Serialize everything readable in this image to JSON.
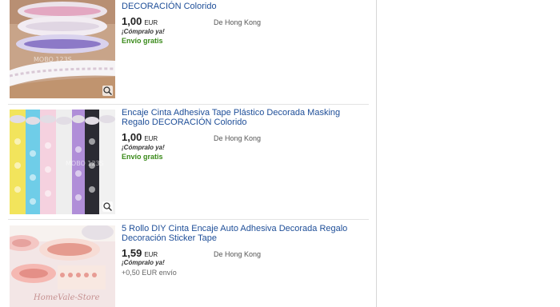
{
  "items": [
    {
      "title": "DECORACIÓN Colorido",
      "price": "1,00",
      "currency": "EUR",
      "buy_now": "¡Cómpralo ya!",
      "origin": "De Hong Kong",
      "shipping": "Envío gratis",
      "image_watermark": "MOBO 123S"
    },
    {
      "title": "Encaje Cinta Adhesiva Tape Plástico Decorada Masking Regalo DECORACIÓN Colorido",
      "price": "1,00",
      "currency": "EUR",
      "buy_now": "¡Cómpralo ya!",
      "origin": "De Hong Kong",
      "shipping": "Envío gratis",
      "image_watermark": "MOBO 123S"
    },
    {
      "title": "5 Rollo DIY Cinta Encaje Auto Adhesiva Decorada Regalo Decoración Sticker Tape",
      "price": "1,59",
      "currency": "EUR",
      "buy_now": "¡Cómpralo ya!",
      "origin": "De Hong Kong",
      "shipping": "+0,50 EUR envío",
      "image_watermark": "HomeVale-Store"
    }
  ],
  "icons": {
    "zoom": "zoom-in-icon",
    "buy_now_mark": "buy-now-logo"
  },
  "colors": {
    "link": "#1e4e98",
    "free_shipping": "#3a8a1a",
    "buy_now_accent": "#d81e1e"
  }
}
